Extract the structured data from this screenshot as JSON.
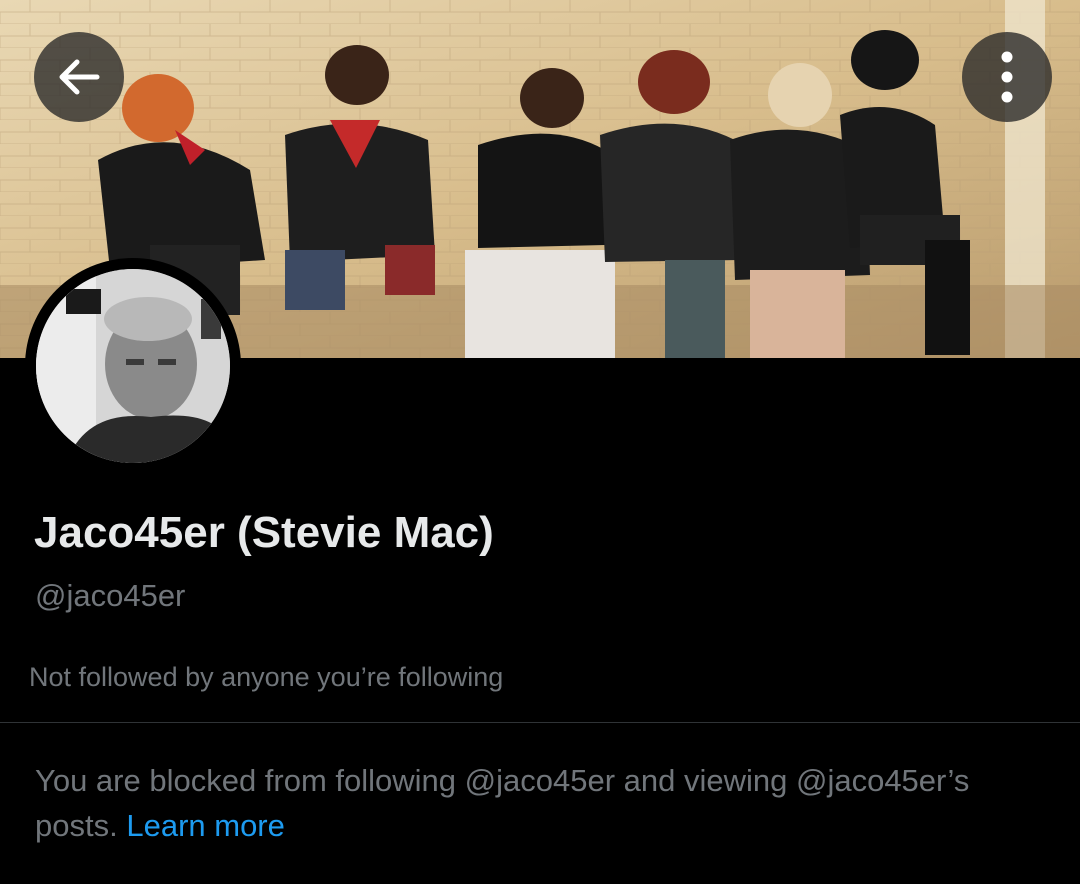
{
  "header": {
    "back_icon": "arrow-left-icon",
    "more_icon": "more-vertical-icon",
    "button_bg": "#282828"
  },
  "banner": {
    "description_icon": "profile-banner-image"
  },
  "profile": {
    "display_name": "Jaco45er (Stevie Mac)",
    "handle": "@jaco45er",
    "followed_by_text": "Not followed by anyone you’re following"
  },
  "notice": {
    "text": "You are blocked from following @jaco45er and viewing @jaco45er’s posts.",
    "link_label": "Learn more"
  },
  "colors": {
    "background": "#000000",
    "primary_text": "#e7e9ea",
    "secondary_text": "#71767b",
    "link": "#1d9bf0",
    "divider": "#2f3336"
  }
}
